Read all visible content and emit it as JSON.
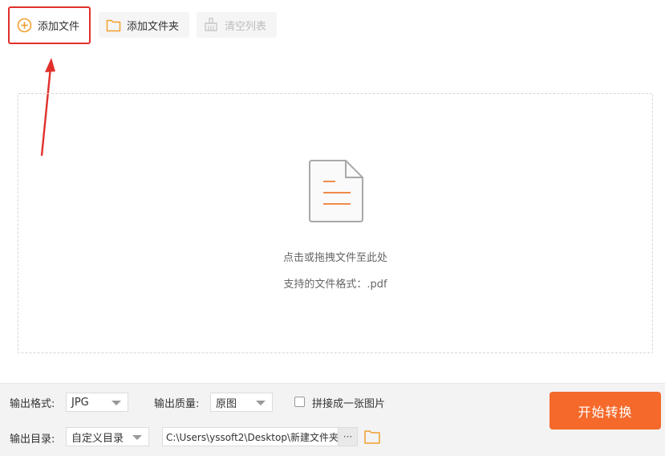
{
  "toolbar": {
    "add_file": "添加文件",
    "add_folder": "添加文件夹",
    "clear_list": "清空列表"
  },
  "dropzone": {
    "hint": "点击或拖拽文件至此处",
    "formats": "支持的文件格式：.pdf"
  },
  "options": {
    "format_label": "输出格式:",
    "format_value": "JPG",
    "quality_label": "输出质量:",
    "quality_value": "原图",
    "merge_label": "拼接成一张图片",
    "dir_label": "输出目录:",
    "dir_mode": "自定义目录",
    "dir_path": "C:\\Users\\yssoft2\\Desktop\\新建文件夹\\",
    "path_more": "···"
  },
  "start_button": "开始转换",
  "colors": {
    "accent": "#f5692a",
    "highlight": "#e0302b",
    "icon_orange": "#f0a030"
  }
}
